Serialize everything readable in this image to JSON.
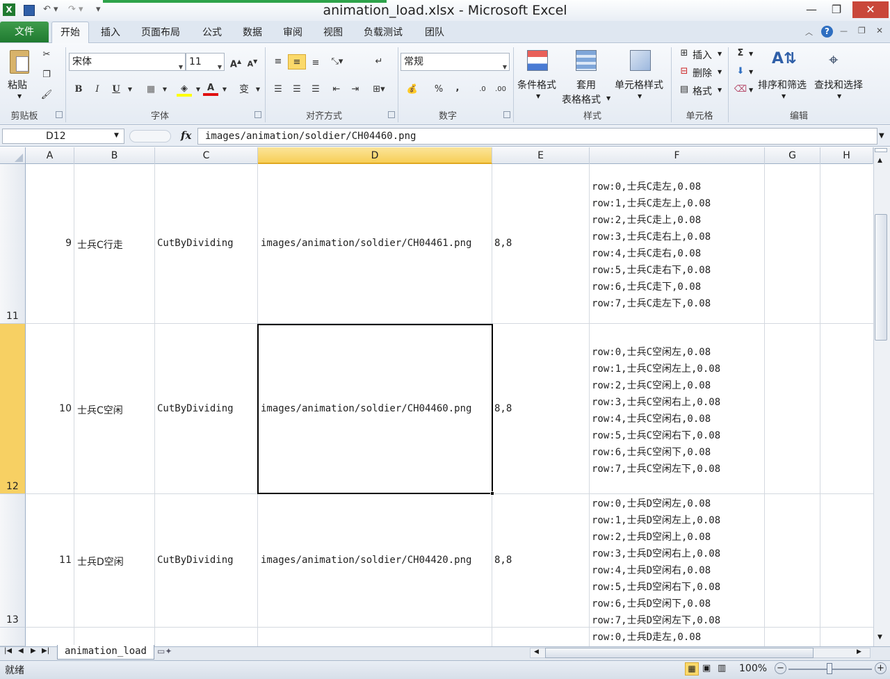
{
  "window": {
    "title": "animation_load.xlsx - Microsoft Excel"
  },
  "tabs": {
    "file": "文件",
    "home": "开始",
    "insert": "插入",
    "page_layout": "页面布局",
    "formulas": "公式",
    "data": "数据",
    "review": "审阅",
    "view": "视图",
    "load_test": "负载测试",
    "team": "团队"
  },
  "ribbon": {
    "clipboard": {
      "label": "剪贴板",
      "paste": "粘贴"
    },
    "font": {
      "label": "字体",
      "name": "宋体",
      "size": "11",
      "bold": "B",
      "italic": "I",
      "underline": "U",
      "grow": "A",
      "shrink": "A",
      "wen": "变"
    },
    "alignment": {
      "label": "对齐方式"
    },
    "number": {
      "label": "数字",
      "format": "常规",
      "percent": "%",
      "comma": ","
    },
    "styles": {
      "label": "样式",
      "conditional": "条件格式",
      "table_fmt_1": "套用",
      "table_fmt_2": "表格格式",
      "cell_styles": "单元格样式"
    },
    "cells": {
      "label": "单元格",
      "insert": "插入",
      "delete": "删除",
      "format": "格式"
    },
    "editing": {
      "label": "编辑",
      "sigma": "Σ",
      "sort": "排序和筛选",
      "find": "查找和选择"
    }
  },
  "formula_bar": {
    "name_box": "D12",
    "fx": "fx",
    "content": "images/animation/soldier/CH04460.png"
  },
  "columns": [
    "A",
    "B",
    "C",
    "D",
    "E",
    "F",
    "G",
    "H"
  ],
  "rows": [
    {
      "row_num": "11",
      "a": "9",
      "b": "士兵C行走",
      "c": "CutByDividing",
      "d": "images/animation/soldier/CH04461.png",
      "e": "8,8",
      "f": [
        "row:0,士兵C走左,0.08",
        "row:1,士兵C走左上,0.08",
        "row:2,士兵C走上,0.08",
        "row:3,士兵C走右上,0.08",
        "row:4,士兵C走右,0.08",
        "row:5,士兵C走右下,0.08",
        "row:6,士兵C走下,0.08",
        "row:7,士兵C走左下,0.08"
      ]
    },
    {
      "row_num": "12",
      "a": "10",
      "b": "士兵C空闲",
      "c": "CutByDividing",
      "d": "images/animation/soldier/CH04460.png",
      "e": "8,8",
      "f": [
        "row:0,士兵C空闲左,0.08",
        "row:1,士兵C空闲左上,0.08",
        "row:2,士兵C空闲上,0.08",
        "row:3,士兵C空闲右上,0.08",
        "row:4,士兵C空闲右,0.08",
        "row:5,士兵C空闲右下,0.08",
        "row:6,士兵C空闲下,0.08",
        "row:7,士兵C空闲左下,0.08"
      ]
    },
    {
      "row_num": "13",
      "a": "11",
      "b": "士兵D空闲",
      "c": "CutByDividing",
      "d": "images/animation/soldier/CH04420.png",
      "e": "8,8",
      "f": [
        "row:0,士兵D空闲左,0.08",
        "row:1,士兵D空闲左上,0.08",
        "row:2,士兵D空闲上,0.08",
        "row:3,士兵D空闲右上,0.08",
        "row:4,士兵D空闲右,0.08",
        "row:5,士兵D空闲右下,0.08",
        "row:6,士兵D空闲下,0.08",
        "row:7,士兵D空闲左下,0.08"
      ]
    },
    {
      "f": [
        "row:0,士兵D走左,0.08"
      ]
    }
  ],
  "sheet_tab": "animation_load",
  "status": {
    "ready": "就绪",
    "zoom": "100%",
    "minus": "−",
    "plus": "+"
  }
}
